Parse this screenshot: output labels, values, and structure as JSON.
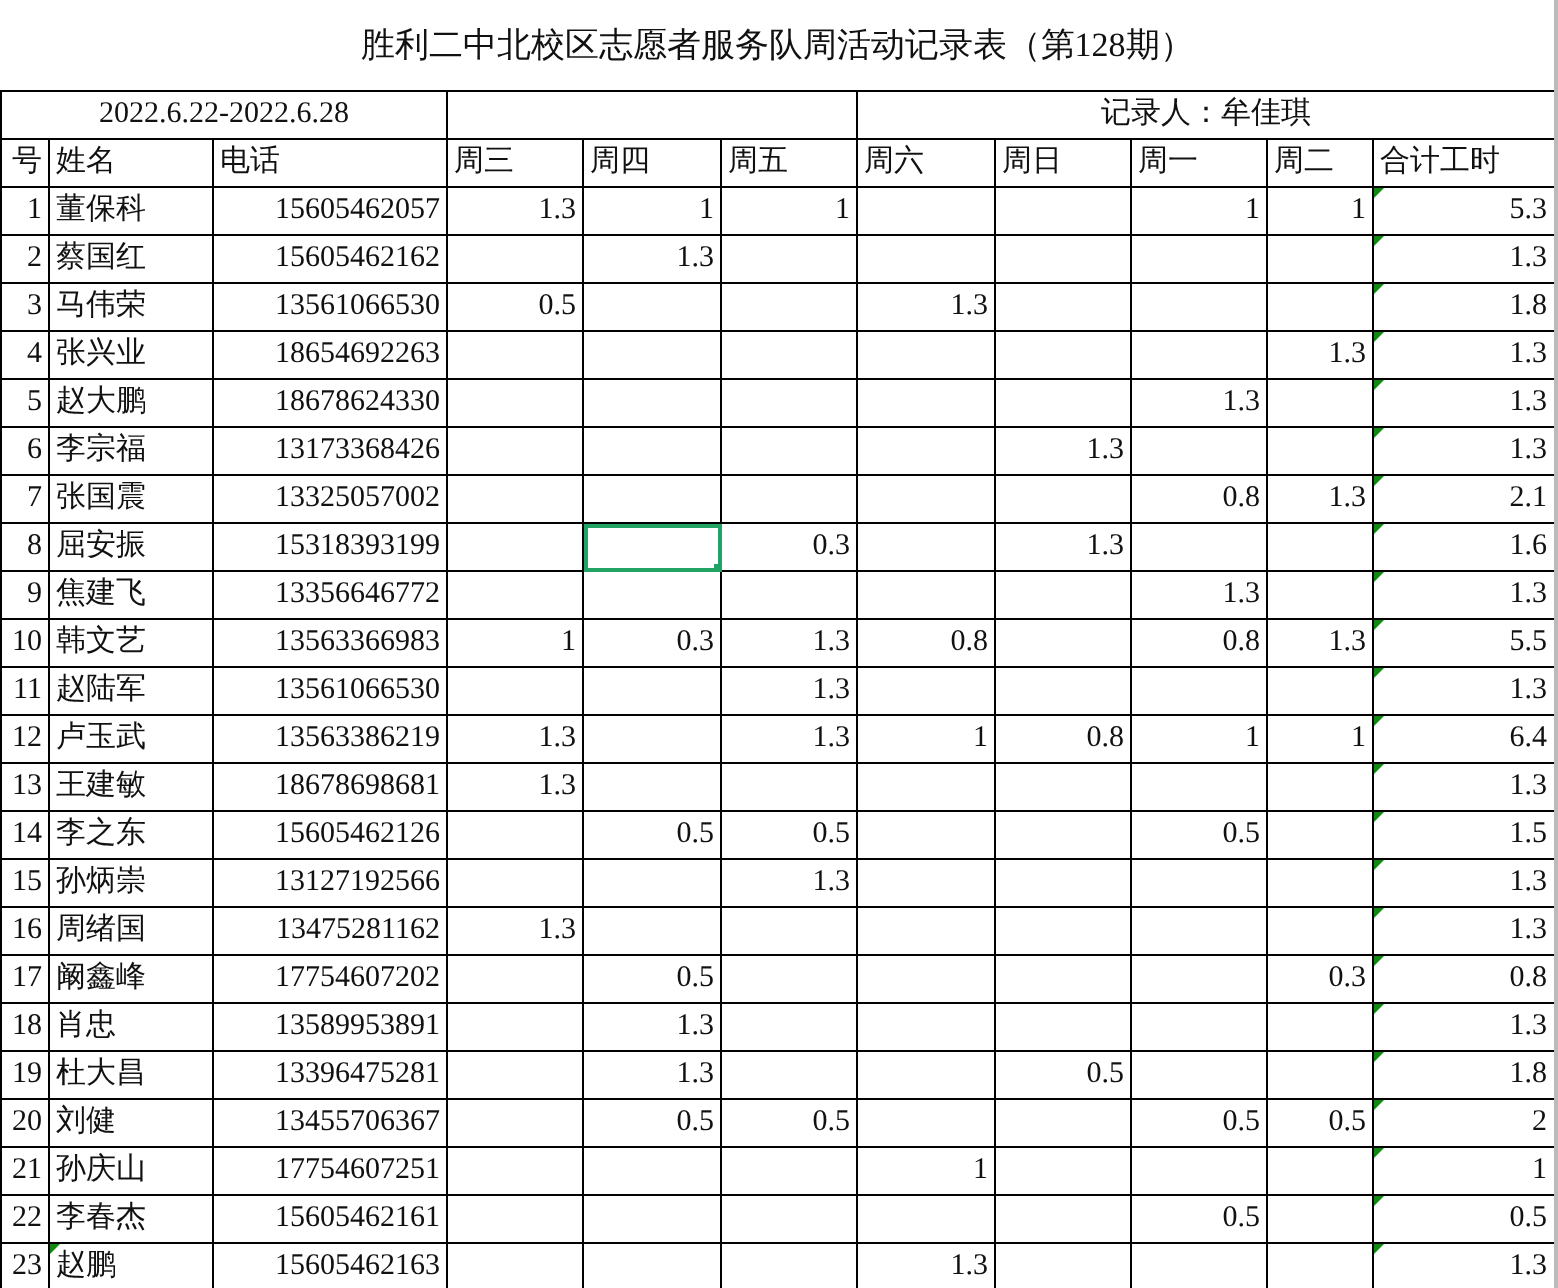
{
  "title": "胜利二中北校区志愿者服务队周活动记录表（第128期）",
  "date_range": "2022.6.22-2022.6.28",
  "recorder": "记录人：牟佳琪",
  "columns": [
    "号",
    "姓名",
    "电话",
    "周三",
    "周四",
    "周五",
    "周六",
    "周日",
    "周一",
    "周二",
    "合计工时"
  ],
  "rows": [
    {
      "no": "1",
      "name": "董保科",
      "name_flag": false,
      "phone": "15605462057",
      "hours": [
        {
          "value": "1.3",
          "selected": false
        },
        {
          "value": "1",
          "selected": false
        },
        {
          "value": "1",
          "selected": false
        },
        {
          "selected": false
        },
        {
          "selected": false
        },
        {
          "value": "1",
          "selected": false
        },
        {
          "value": "1",
          "selected": false
        }
      ],
      "total": "5.3",
      "total_flag": true
    },
    {
      "no": "2",
      "name": "蔡国红",
      "name_flag": false,
      "phone": "15605462162",
      "hours": [
        {
          "selected": false
        },
        {
          "value": "1.3",
          "selected": false
        },
        {
          "selected": false
        },
        {
          "selected": false
        },
        {
          "selected": false
        },
        {
          "selected": false
        },
        {
          "selected": false
        }
      ],
      "total": "1.3",
      "total_flag": true
    },
    {
      "no": "3",
      "name": "马伟荣",
      "name_flag": false,
      "phone": "13561066530",
      "hours": [
        {
          "value": "0.5",
          "selected": false
        },
        {
          "selected": false
        },
        {
          "selected": false
        },
        {
          "value": "1.3",
          "selected": false
        },
        {
          "selected": false
        },
        {
          "selected": false
        },
        {
          "selected": false
        }
      ],
      "total": "1.8",
      "total_flag": true
    },
    {
      "no": "4",
      "name": "张兴业",
      "name_flag": false,
      "phone": "18654692263",
      "hours": [
        {
          "selected": false
        },
        {
          "selected": false
        },
        {
          "selected": false
        },
        {
          "selected": false
        },
        {
          "selected": false
        },
        {
          "selected": false
        },
        {
          "value": "1.3",
          "selected": false
        }
      ],
      "total": "1.3",
      "total_flag": true
    },
    {
      "no": "5",
      "name": "赵大鹏",
      "name_flag": false,
      "phone": "18678624330",
      "hours": [
        {
          "selected": false
        },
        {
          "selected": false
        },
        {
          "selected": false
        },
        {
          "selected": false
        },
        {
          "selected": false
        },
        {
          "value": "1.3",
          "selected": false
        },
        {
          "selected": false
        }
      ],
      "total": "1.3",
      "total_flag": true
    },
    {
      "no": "6",
      "name": "李宗福",
      "name_flag": false,
      "phone": "13173368426",
      "hours": [
        {
          "selected": false
        },
        {
          "selected": false
        },
        {
          "selected": false
        },
        {
          "selected": false
        },
        {
          "value": "1.3",
          "selected": false
        },
        {
          "selected": false
        },
        {
          "selected": false
        }
      ],
      "total": "1.3",
      "total_flag": true
    },
    {
      "no": "7",
      "name": "张国震",
      "name_flag": false,
      "phone": "13325057002",
      "hours": [
        {
          "selected": false
        },
        {
          "selected": false
        },
        {
          "selected": false
        },
        {
          "selected": false
        },
        {
          "selected": false
        },
        {
          "value": "0.8",
          "selected": false
        },
        {
          "value": "1.3",
          "selected": false
        }
      ],
      "total": "2.1",
      "total_flag": true
    },
    {
      "no": "8",
      "name": "屈安振",
      "name_flag": false,
      "phone": "15318393199",
      "hours": [
        {
          "selected": false
        },
        {
          "selected": true
        },
        {
          "value": "0.3",
          "selected": false
        },
        {
          "selected": false
        },
        {
          "value": "1.3",
          "selected": false
        },
        {
          "selected": false
        },
        {
          "selected": false
        }
      ],
      "total": "1.6",
      "total_flag": true
    },
    {
      "no": "9",
      "name": "焦建飞",
      "name_flag": false,
      "phone": "13356646772",
      "hours": [
        {
          "selected": false
        },
        {
          "selected": false
        },
        {
          "selected": false
        },
        {
          "selected": false
        },
        {
          "selected": false
        },
        {
          "value": "1.3",
          "selected": false
        },
        {
          "selected": false
        }
      ],
      "total": "1.3",
      "total_flag": true
    },
    {
      "no": "10",
      "name": "韩文艺",
      "name_flag": false,
      "phone": "13563366983",
      "hours": [
        {
          "value": "1",
          "selected": false
        },
        {
          "value": "0.3",
          "selected": false
        },
        {
          "value": "1.3",
          "selected": false
        },
        {
          "value": "0.8",
          "selected": false
        },
        {
          "selected": false
        },
        {
          "value": "0.8",
          "selected": false
        },
        {
          "value": "1.3",
          "selected": false
        }
      ],
      "total": "5.5",
      "total_flag": true
    },
    {
      "no": "11",
      "name": "赵陆军",
      "name_flag": false,
      "phone": "13561066530",
      "hours": [
        {
          "selected": false
        },
        {
          "selected": false
        },
        {
          "value": "1.3",
          "selected": false
        },
        {
          "selected": false
        },
        {
          "selected": false
        },
        {
          "selected": false
        },
        {
          "selected": false
        }
      ],
      "total": "1.3",
      "total_flag": true
    },
    {
      "no": "12",
      "name": "卢玉武",
      "name_flag": false,
      "phone": "13563386219",
      "hours": [
        {
          "value": "1.3",
          "selected": false
        },
        {
          "selected": false
        },
        {
          "value": "1.3",
          "selected": false
        },
        {
          "value": "1",
          "selected": false
        },
        {
          "value": "0.8",
          "selected": false
        },
        {
          "value": "1",
          "selected": false
        },
        {
          "value": "1",
          "selected": false
        }
      ],
      "total": "6.4",
      "total_flag": true
    },
    {
      "no": "13",
      "name": "王建敏",
      "name_flag": false,
      "phone": "18678698681",
      "hours": [
        {
          "value": "1.3",
          "selected": false
        },
        {
          "selected": false
        },
        {
          "selected": false
        },
        {
          "selected": false
        },
        {
          "selected": false
        },
        {
          "selected": false
        },
        {
          "selected": false
        }
      ],
      "total": "1.3",
      "total_flag": true
    },
    {
      "no": "14",
      "name": "李之东",
      "name_flag": false,
      "phone": "15605462126",
      "hours": [
        {
          "selected": false
        },
        {
          "value": "0.5",
          "selected": false
        },
        {
          "value": "0.5",
          "selected": false
        },
        {
          "selected": false
        },
        {
          "selected": false
        },
        {
          "value": "0.5",
          "selected": false
        },
        {
          "selected": false
        }
      ],
      "total": "1.5",
      "total_flag": true
    },
    {
      "no": "15",
      "name": "孙炳崇",
      "name_flag": false,
      "phone": "13127192566",
      "hours": [
        {
          "selected": false
        },
        {
          "selected": false
        },
        {
          "value": "1.3",
          "selected": false
        },
        {
          "selected": false
        },
        {
          "selected": false
        },
        {
          "selected": false
        },
        {
          "selected": false
        }
      ],
      "total": "1.3",
      "total_flag": true
    },
    {
      "no": "16",
      "name": "周绪国",
      "name_flag": false,
      "phone": "13475281162",
      "hours": [
        {
          "value": "1.3",
          "selected": false
        },
        {
          "selected": false
        },
        {
          "selected": false
        },
        {
          "selected": false
        },
        {
          "selected": false
        },
        {
          "selected": false
        },
        {
          "selected": false
        }
      ],
      "total": "1.3",
      "total_flag": true
    },
    {
      "no": "17",
      "name": "阚鑫峰",
      "name_flag": false,
      "phone": "17754607202",
      "hours": [
        {
          "selected": false
        },
        {
          "value": "0.5",
          "selected": false
        },
        {
          "selected": false
        },
        {
          "selected": false
        },
        {
          "selected": false
        },
        {
          "selected": false
        },
        {
          "value": "0.3",
          "selected": false
        }
      ],
      "total": "0.8",
      "total_flag": true
    },
    {
      "no": "18",
      "name": "肖忠",
      "name_flag": false,
      "phone": "13589953891",
      "hours": [
        {
          "selected": false
        },
        {
          "value": "1.3",
          "selected": false
        },
        {
          "selected": false
        },
        {
          "selected": false
        },
        {
          "selected": false
        },
        {
          "selected": false
        },
        {
          "selected": false
        }
      ],
      "total": "1.3",
      "total_flag": true
    },
    {
      "no": "19",
      "name": "杜大昌",
      "name_flag": false,
      "phone": "13396475281",
      "hours": [
        {
          "selected": false
        },
        {
          "value": "1.3",
          "selected": false
        },
        {
          "selected": false
        },
        {
          "selected": false
        },
        {
          "value": "0.5",
          "selected": false
        },
        {
          "selected": false
        },
        {
          "selected": false
        }
      ],
      "total": "1.8",
      "total_flag": true
    },
    {
      "no": "20",
      "name": "刘健",
      "name_flag": false,
      "phone": "13455706367",
      "hours": [
        {
          "selected": false
        },
        {
          "value": "0.5",
          "selected": false
        },
        {
          "value": "0.5",
          "selected": false
        },
        {
          "selected": false
        },
        {
          "selected": false
        },
        {
          "value": "0.5",
          "selected": false
        },
        {
          "value": "0.5",
          "selected": false
        }
      ],
      "total": "2",
      "total_flag": true
    },
    {
      "no": "21",
      "name": "孙庆山",
      "name_flag": false,
      "phone": "17754607251",
      "hours": [
        {
          "selected": false
        },
        {
          "selected": false
        },
        {
          "selected": false
        },
        {
          "value": "1",
          "selected": false
        },
        {
          "selected": false
        },
        {
          "selected": false
        },
        {
          "selected": false
        }
      ],
      "total": "1",
      "total_flag": true
    },
    {
      "no": "22",
      "name": "李春杰",
      "name_flag": false,
      "phone": "15605462161",
      "hours": [
        {
          "selected": false
        },
        {
          "selected": false
        },
        {
          "selected": false
        },
        {
          "selected": false
        },
        {
          "selected": false
        },
        {
          "value": "0.5",
          "selected": false
        },
        {
          "selected": false
        }
      ],
      "total": "0.5",
      "total_flag": true
    },
    {
      "no": "23",
      "name": "赵鹏",
      "name_flag": true,
      "phone": "15605462163",
      "hours": [
        {
          "selected": false
        },
        {
          "selected": false
        },
        {
          "selected": false
        },
        {
          "value": "1.3",
          "selected": false
        },
        {
          "selected": false
        },
        {
          "selected": false
        },
        {
          "selected": false
        }
      ],
      "total": "1.3",
      "total_flag": true
    }
  ]
}
